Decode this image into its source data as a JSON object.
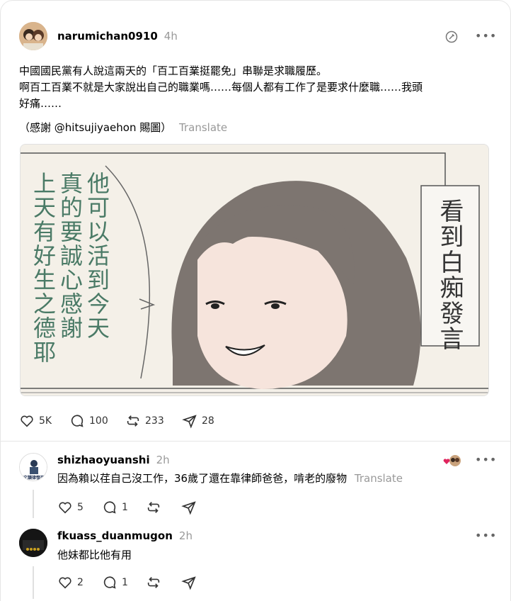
{
  "post": {
    "username": "narumichan0910",
    "time": "4h",
    "line1": "中國國民黨有人說這兩天的「百工百業挺罷免」串聯是求職履歷。",
    "line2": "啊百工百業不就是大家說出自己的職業嗎……每個人都有工作了是要求什麼職……我頭",
    "line3": "好痛……",
    "credit": "（感謝 @hitsujiyaehon 賜圖）",
    "translate": "Translate",
    "image": {
      "speech_col1": "他可以活到今天",
      "speech_col2": "真的要誠心感謝",
      "speech_col3": "上天有好生之德耶",
      "box_text": "看到白痴發言"
    },
    "likes": "5K",
    "replies": "100",
    "reposts": "233",
    "shares": "28"
  },
  "replies": [
    {
      "username": "shizhaoyuanshi",
      "time": "2h",
      "text": "因為賴以荏自己沒工作，36歲了還在靠律師爸爸，啃老的廢物",
      "translate": "Translate",
      "likes": "5",
      "replies": "1",
      "avatar_caption": "文韻律惶恐"
    },
    {
      "username": "fkuass_duanmugon",
      "time": "2h",
      "text": "他妹都比他有用",
      "likes": "2",
      "replies": "1"
    }
  ],
  "icons": {
    "more": "more-horizontal-icon",
    "like": "heart-icon",
    "reply": "speech-bubble-icon",
    "repost": "repost-icon",
    "share": "paper-plane-icon",
    "edit": "edit-circle-icon"
  },
  "colors": {
    "muted": "#999999",
    "speech_text": "#4a7a66",
    "like_red": "#e0245e"
  }
}
